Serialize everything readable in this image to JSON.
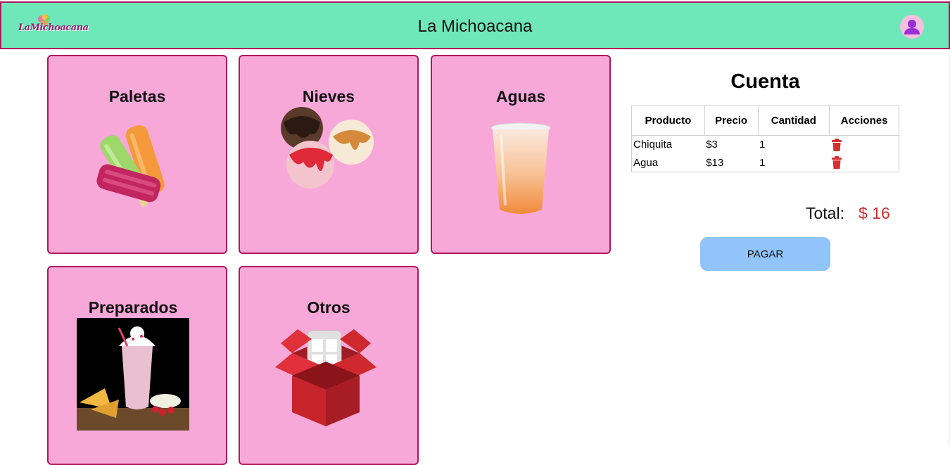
{
  "header": {
    "logo_text": "LaMichoacana",
    "title": "La Michoacana"
  },
  "categories": [
    {
      "label": "Paletas",
      "icon": "paletas-image"
    },
    {
      "label": "Nieves",
      "icon": "nieves-image"
    },
    {
      "label": "Aguas",
      "icon": "aguas-image"
    },
    {
      "label": "Preparados",
      "icon": "preparados-image"
    },
    {
      "label": "Otros",
      "icon": "otros-image"
    }
  ],
  "cuenta": {
    "title": "Cuenta",
    "columns": [
      "Producto",
      "Precio",
      "Cantidad",
      "Acciones"
    ],
    "rows": [
      {
        "producto": "Chiquita",
        "precio": "$3",
        "cantidad": "1"
      },
      {
        "producto": "Agua",
        "precio": "$13",
        "cantidad": "1"
      }
    ],
    "total_label": "Total:",
    "total_value": "$ 16",
    "pay_label": "PAGAR"
  },
  "colors": {
    "header_bg": "#6ee8b8",
    "card_bg": "#f8a8d8",
    "border": "#b0185a",
    "pay_button": "#90c4fb",
    "total_value": "#d22f2f",
    "trash": "#d32f2f",
    "avatar": "#9b2fd6"
  }
}
